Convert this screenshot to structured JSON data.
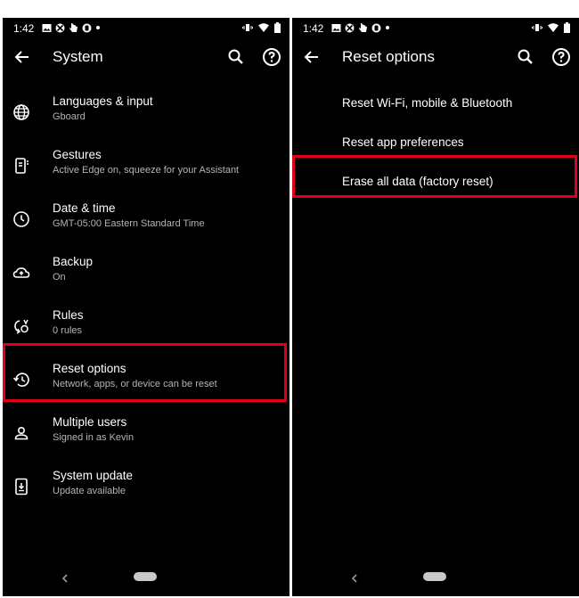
{
  "status_bar": {
    "time": "1:42"
  },
  "left_screen": {
    "title": "System",
    "items": [
      {
        "title": "Languages & input",
        "subtitle": "Gboard"
      },
      {
        "title": "Gestures",
        "subtitle": "Active Edge on, squeeze for your Assistant"
      },
      {
        "title": "Date & time",
        "subtitle": "GMT-05:00 Eastern Standard Time"
      },
      {
        "title": "Backup",
        "subtitle": "On"
      },
      {
        "title": "Rules",
        "subtitle": "0 rules"
      },
      {
        "title": "Reset options",
        "subtitle": "Network, apps, or device can be reset"
      },
      {
        "title": "Multiple users",
        "subtitle": "Signed in as Kevin"
      },
      {
        "title": "System update",
        "subtitle": "Update available"
      }
    ]
  },
  "right_screen": {
    "title": "Reset options",
    "items": [
      {
        "title": "Reset Wi-Fi, mobile & Bluetooth"
      },
      {
        "title": "Reset app preferences"
      },
      {
        "title": "Erase all data (factory reset)"
      }
    ]
  },
  "colors": {
    "background": "#000000",
    "text": "#ffffff",
    "secondary_text": "#b4b4b4",
    "highlight": "#e0001a"
  },
  "icons": {
    "status": [
      "photo-icon",
      "xbox-icon",
      "hand-icon",
      "shield-app-icon",
      "dot-icon",
      "vibrate-icon",
      "wifi-icon",
      "battery-icon"
    ],
    "left_items": [
      "globe-icon",
      "gesture-phone-icon",
      "clock-icon",
      "cloud-upload-icon",
      "rules-icon",
      "history-icon",
      "person-icon",
      "system-update-icon"
    ]
  }
}
